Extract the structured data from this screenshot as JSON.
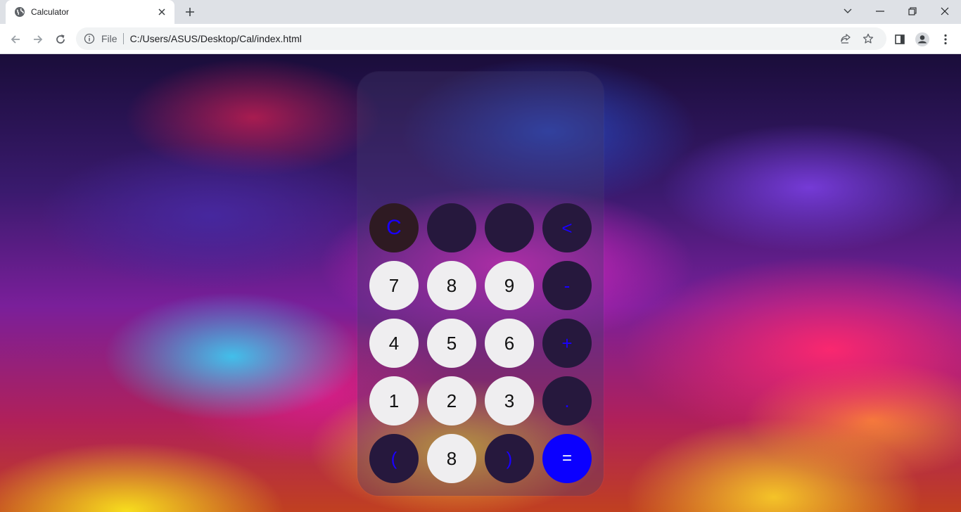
{
  "browser": {
    "tab": {
      "title": "Calculator"
    },
    "omnibox": {
      "scheme_label": "File",
      "url": "C:/Users/ASUS/Desktop/Cal/index.html"
    }
  },
  "calculator": {
    "display": "",
    "keys": [
      {
        "label": "C",
        "kind": "clear"
      },
      {
        "label": "",
        "kind": "op"
      },
      {
        "label": "",
        "kind": "op"
      },
      {
        "label": "<",
        "kind": "op"
      },
      {
        "label": "7",
        "kind": "digit"
      },
      {
        "label": "8",
        "kind": "digit"
      },
      {
        "label": "9",
        "kind": "digit"
      },
      {
        "label": "-",
        "kind": "op"
      },
      {
        "label": "4",
        "kind": "digit"
      },
      {
        "label": "5",
        "kind": "digit"
      },
      {
        "label": "6",
        "kind": "digit"
      },
      {
        "label": "+",
        "kind": "op"
      },
      {
        "label": "1",
        "kind": "digit"
      },
      {
        "label": "2",
        "kind": "digit"
      },
      {
        "label": "3",
        "kind": "digit"
      },
      {
        "label": ".",
        "kind": "op"
      },
      {
        "label": "(",
        "kind": "op"
      },
      {
        "label": "8",
        "kind": "digit"
      },
      {
        "label": ")",
        "kind": "op"
      },
      {
        "label": "=",
        "kind": "equals"
      }
    ]
  },
  "colors": {
    "digit_key": "#efeef0",
    "operator_key": "#26183d",
    "operator_text": "#1a00ff",
    "equals_key": "#0b00ff"
  }
}
